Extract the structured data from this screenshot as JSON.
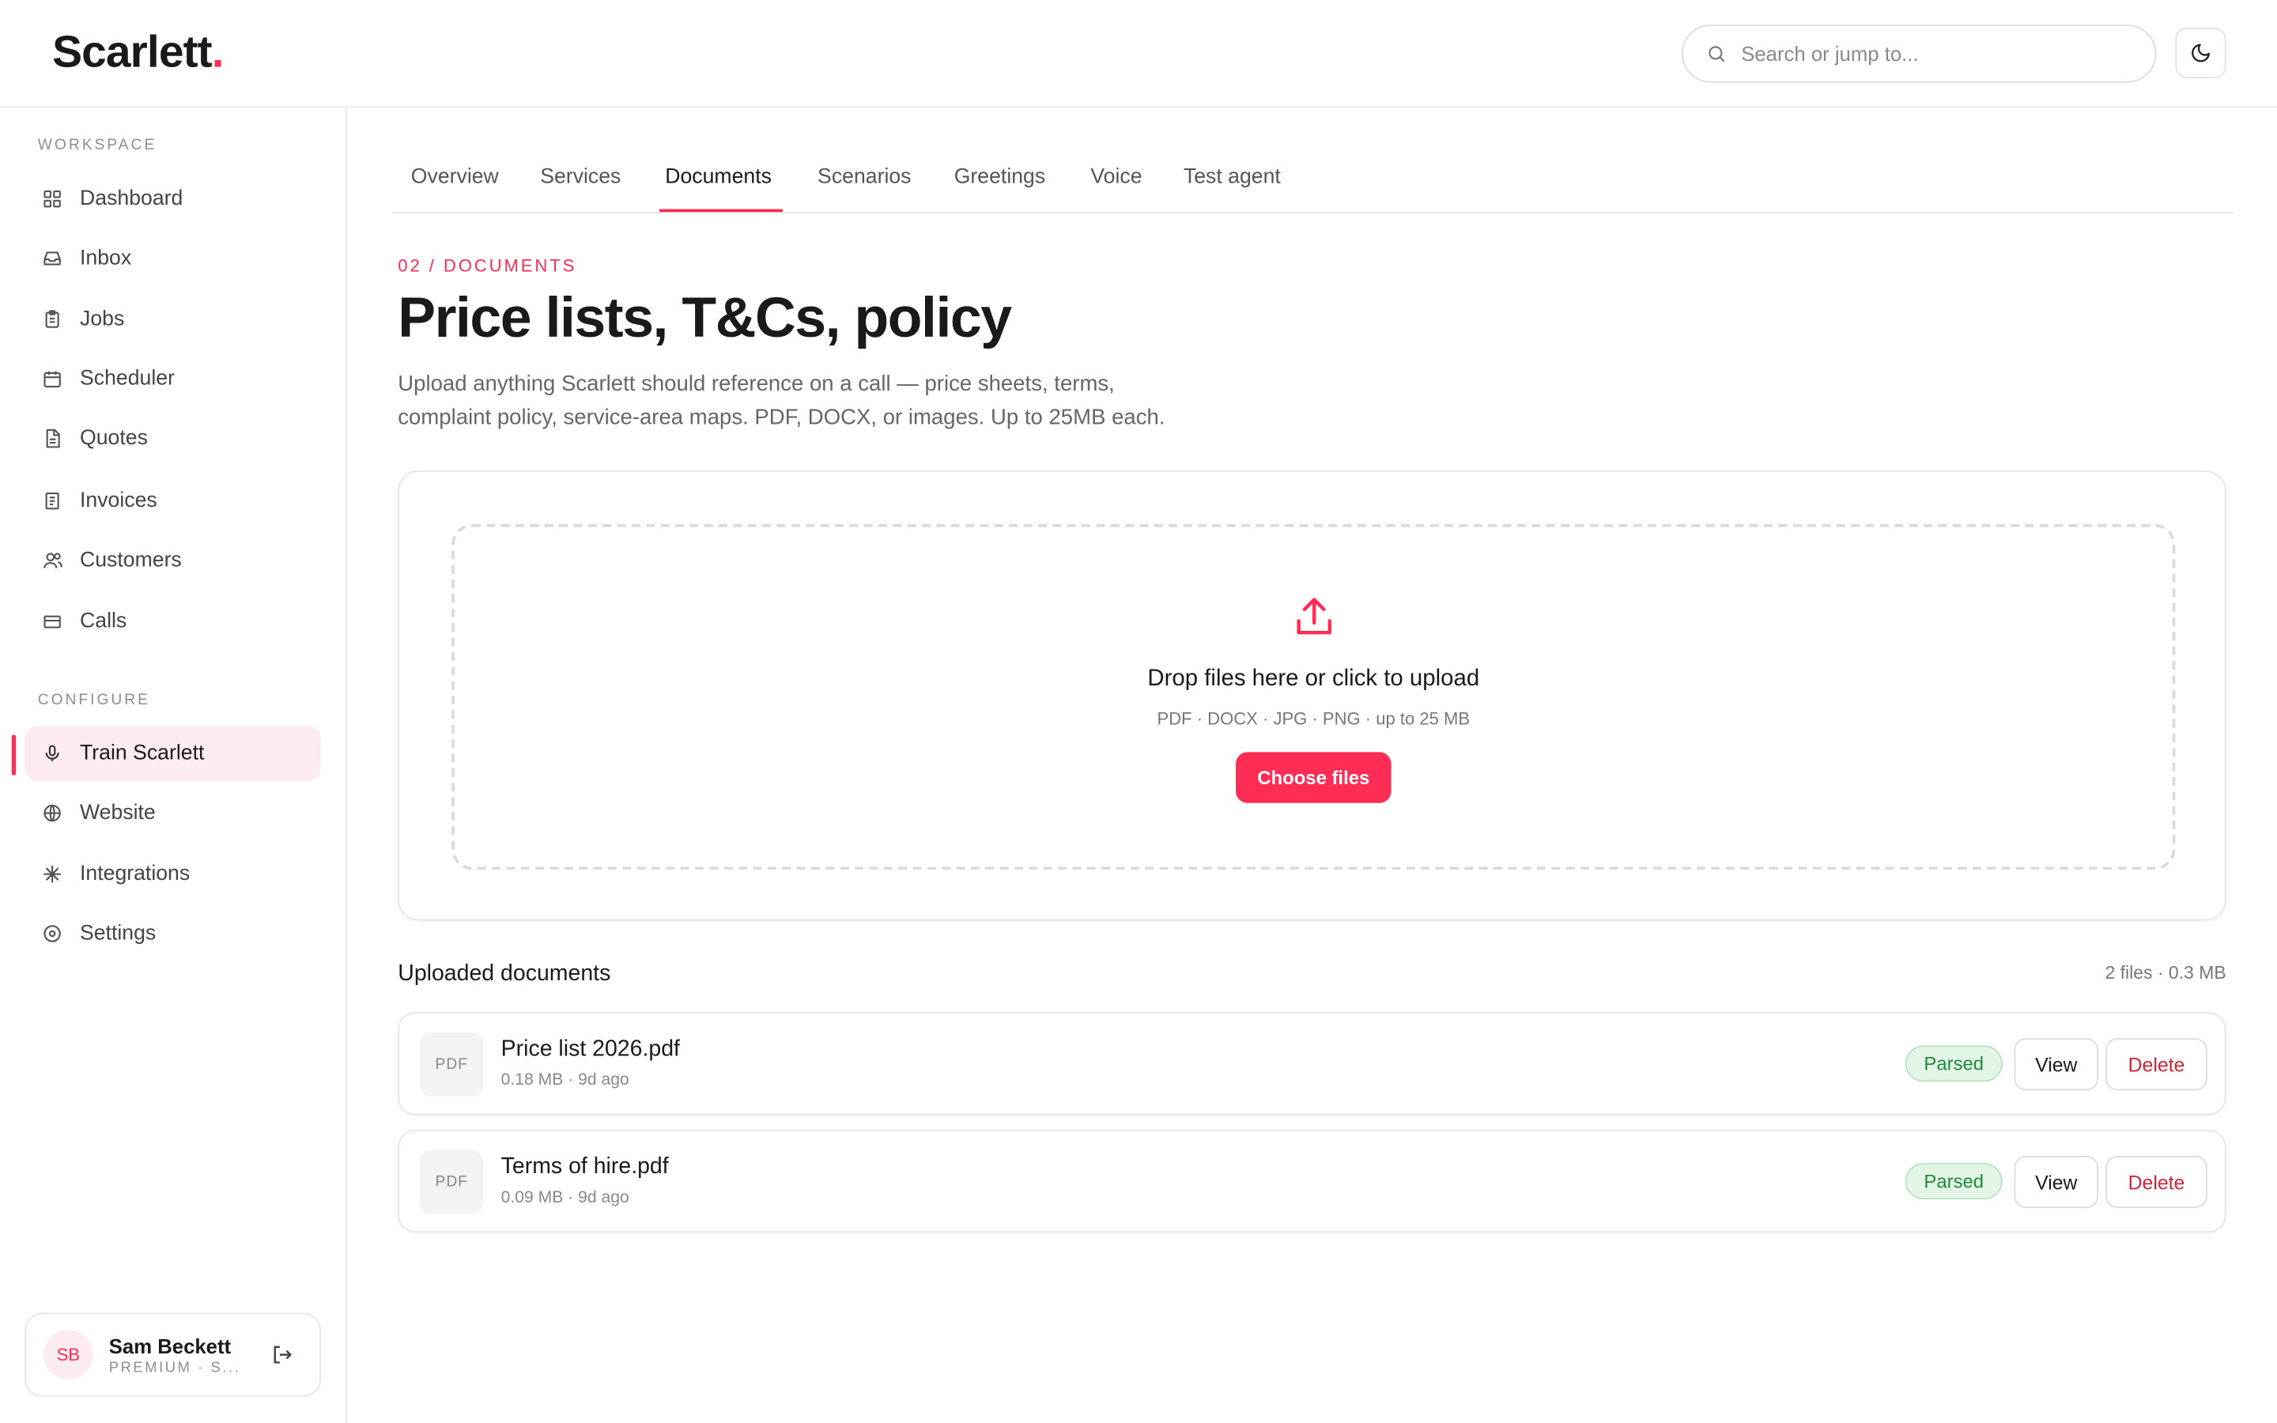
{
  "app": {
    "logo_text": "Scarlett",
    "logo_dot": "."
  },
  "search": {
    "placeholder": "Search or jump to..."
  },
  "sidebar": {
    "workspace_label": "WORKSPACE",
    "configure_label": "CONFIGURE",
    "workspace_items": [
      {
        "label": "Dashboard",
        "icon": "grid-icon"
      },
      {
        "label": "Inbox",
        "icon": "inbox-icon"
      },
      {
        "label": "Jobs",
        "icon": "clipboard-icon"
      },
      {
        "label": "Scheduler",
        "icon": "calendar-icon"
      },
      {
        "label": "Quotes",
        "icon": "file-icon"
      },
      {
        "label": "Invoices",
        "icon": "receipt-icon"
      },
      {
        "label": "Customers",
        "icon": "users-icon"
      },
      {
        "label": "Calls",
        "icon": "card-icon"
      }
    ],
    "configure_items": [
      {
        "label": "Train Scarlett",
        "icon": "mic-icon",
        "active": true
      },
      {
        "label": "Website",
        "icon": "globe-icon"
      },
      {
        "label": "Integrations",
        "icon": "sparkle-icon"
      },
      {
        "label": "Settings",
        "icon": "target-icon"
      }
    ],
    "user": {
      "initials": "SB",
      "name": "Sam Beckett",
      "plan": "PREMIUM · S..."
    }
  },
  "tabs": [
    {
      "label": "Overview"
    },
    {
      "label": "Services"
    },
    {
      "label": "Documents",
      "active": true
    },
    {
      "label": "Scenarios"
    },
    {
      "label": "Greetings"
    },
    {
      "label": "Voice"
    },
    {
      "label": "Test agent"
    }
  ],
  "main": {
    "eyebrow": "02 / DOCUMENTS",
    "title": "Price lists, T&Cs, policy",
    "description": "Upload anything Scarlett should reference on a call — price sheets, terms, complaint policy, service-area maps. PDF, DOCX, or images. Up to 25MB each."
  },
  "upload": {
    "title": "Drop files here or click to upload",
    "subtitle": "PDF · DOCX · JPG · PNG · up to 25 MB",
    "button": "Choose files"
  },
  "uploaded": {
    "title": "Uploaded documents",
    "summary": "2 files · 0.3 MB",
    "files": [
      {
        "type": "PDF",
        "name": "Price list 2026.pdf",
        "meta": "0.18 MB · 9d ago",
        "status": "Parsed",
        "view": "View",
        "delete": "Delete"
      },
      {
        "type": "PDF",
        "name": "Terms of hire.pdf",
        "meta": "0.09 MB · 9d ago",
        "status": "Parsed",
        "view": "View",
        "delete": "Delete"
      }
    ]
  },
  "colors": {
    "accent": "#ff2d55",
    "success": "#1f8a3a",
    "danger": "#d0243a"
  }
}
